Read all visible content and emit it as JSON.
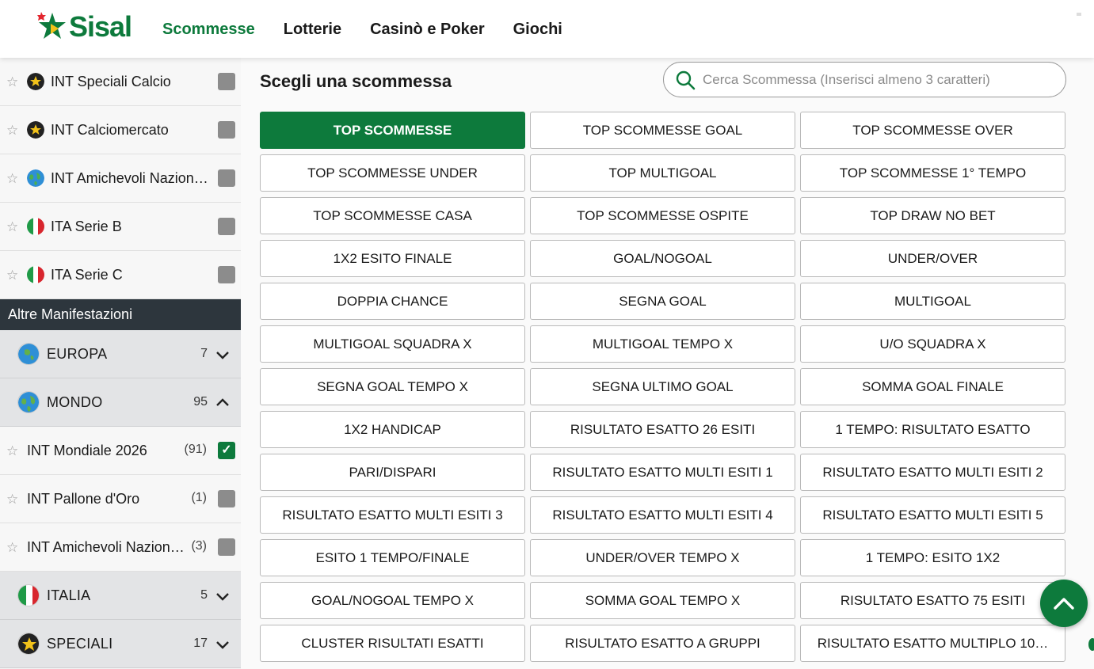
{
  "header": {
    "brand": "Sisal",
    "nav": [
      {
        "label": "Scommesse",
        "active": true
      },
      {
        "label": "Lotterie",
        "active": false
      },
      {
        "label": "Casinò e Poker",
        "active": false
      },
      {
        "label": "Giochi",
        "active": false
      }
    ]
  },
  "sidebar": {
    "top_items": [
      {
        "label": "INT Speciali Calcio",
        "flag": "star-icon",
        "checked": false
      },
      {
        "label": "INT Calciomercato",
        "flag": "star-icon",
        "checked": false
      },
      {
        "label": "INT Amichevoli Nazion…",
        "flag": "globe-icon",
        "checked": false
      },
      {
        "label": "ITA Serie B",
        "flag": "italy-flag-icon",
        "checked": false
      },
      {
        "label": "ITA Serie C",
        "flag": "italy-flag-icon",
        "checked": false
      }
    ],
    "section_title": "Altre Manifestazioni",
    "groups": [
      {
        "label": "EUROPA",
        "count": "7",
        "expanded": false,
        "flag": "europe-globe-icon"
      },
      {
        "label": "MONDO",
        "count": "95",
        "expanded": true,
        "flag": "world-globe-icon",
        "children": [
          {
            "label": "INT Mondiale 2026",
            "count": "(91)",
            "checked": true
          },
          {
            "label": "INT Pallone d'Oro",
            "count": "(1)",
            "checked": false
          },
          {
            "label": "INT Amichevoli Nazion…",
            "count": "(3)",
            "checked": false
          }
        ]
      },
      {
        "label": "ITALIA",
        "count": "5",
        "expanded": false,
        "flag": "italy-flag-icon"
      },
      {
        "label": "SPECIALI",
        "count": "17",
        "expanded": false,
        "flag": "star-icon"
      }
    ]
  },
  "main": {
    "title": "Scegli una scommessa",
    "search_placeholder": "Cerca Scommessa (Inserisci almeno 3 caratteri)",
    "bets": [
      "TOP SCOMMESSE",
      "TOP SCOMMESSE GOAL",
      "TOP SCOMMESSE OVER",
      "TOP SCOMMESSE UNDER",
      "TOP MULTIGOAL",
      "TOP SCOMMESSE 1° TEMPO",
      "TOP SCOMMESSE CASA",
      "TOP SCOMMESSE OSPITE",
      "TOP DRAW NO BET",
      "1X2 ESITO FINALE",
      "GOAL/NOGOAL",
      "UNDER/OVER",
      "DOPPIA CHANCE",
      "SEGNA GOAL",
      "MULTIGOAL",
      "MULTIGOAL SQUADRA X",
      "MULTIGOAL TEMPO X",
      "U/O SQUADRA X",
      "SEGNA GOAL TEMPO X",
      "SEGNA ULTIMO GOAL",
      "SOMMA GOAL FINALE",
      "1X2 HANDICAP",
      "RISULTATO ESATTO 26 ESITI",
      "1 TEMPO: RISULTATO ESATTO",
      "PARI/DISPARI",
      "RISULTATO ESATTO MULTI ESITI 1",
      "RISULTATO ESATTO MULTI ESITI 2",
      "RISULTATO ESATTO MULTI ESITI 3",
      "RISULTATO ESATTO MULTI ESITI 4",
      "RISULTATO ESATTO MULTI ESITI 5",
      "ESITO 1 TEMPO/FINALE",
      "UNDER/OVER TEMPO X",
      "1 TEMPO: ESITO 1X2",
      "GOAL/NOGOAL TEMPO X",
      "SOMMA GOAL TEMPO X",
      "RISULTATO ESATTO 75 ESITI",
      "CLUSTER RISULTATI ESATTI",
      "RISULTATO ESATTO A GRUPPI",
      "RISULTATO ESATTO MULTIPLO 10…"
    ],
    "active_bet_index": 0
  },
  "colors": {
    "brand_green": "#0d7a3c",
    "section_dark": "#2d363d"
  }
}
